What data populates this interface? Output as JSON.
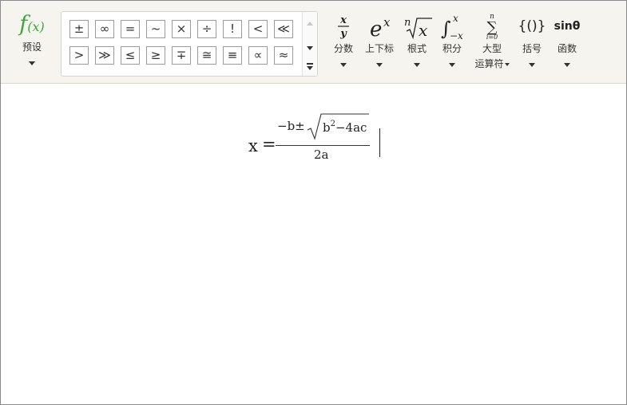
{
  "preset": {
    "icon": "fx-icon",
    "label": "预设"
  },
  "palette": {
    "symbols": [
      "±",
      "∞",
      "=",
      "~",
      "×",
      "÷",
      "!",
      "<",
      "≪",
      ">",
      "≫",
      "≤",
      "≥",
      "∓",
      "≅",
      "≡",
      "∝",
      "≈"
    ]
  },
  "tools": [
    {
      "name": "fraction",
      "label": "分数"
    },
    {
      "name": "script",
      "label": "上下标"
    },
    {
      "name": "radical",
      "label": "根式"
    },
    {
      "name": "integral",
      "label": "积分"
    },
    {
      "name": "large-operator",
      "label": "大型",
      "label2": "运算符"
    },
    {
      "name": "bracket",
      "label": "括号"
    },
    {
      "name": "function",
      "label": "函数"
    }
  ],
  "icons": {
    "fraction_num": "x",
    "fraction_den": "y",
    "script_base": "e",
    "script_sup": "x",
    "radical_index": "n",
    "radical_body": "x",
    "integral_sup": "x",
    "integral_sub": "−x",
    "sum_top": "n",
    "sum_bottom": "i=0",
    "bracket": "{()}",
    "function": "sinθ"
  },
  "formula": {
    "lhs": "x",
    "eq": "=",
    "num_prefix": "−b±",
    "radicand_base": "b",
    "radicand_exp": "2",
    "radicand_rest": "−4ac",
    "denominator": "2a"
  }
}
